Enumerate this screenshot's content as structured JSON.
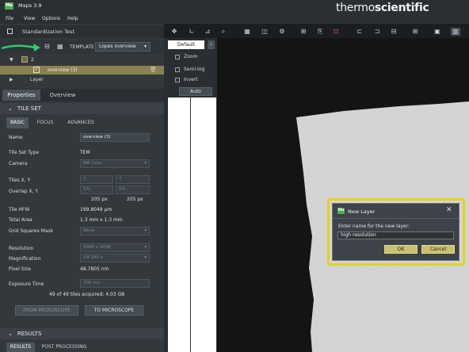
{
  "app": {
    "title": "Maps 3.9",
    "logo_text": "Ma",
    "brand_light": "thermo",
    "brand_bold": "scientific"
  },
  "menu": [
    "File",
    "View",
    "Options",
    "Help"
  ],
  "project": {
    "name": "Standardization Test"
  },
  "template": {
    "label": "TEMPLATE",
    "selected": "Lopes overview"
  },
  "tree": {
    "group_count": "2",
    "item": "overview (3)",
    "layer": "Layer"
  },
  "panel_tabs": {
    "properties": "Properties",
    "overview": "Overview"
  },
  "tile_set": {
    "header": "TILE SET",
    "tabs": [
      "BASIC",
      "FOCUS",
      "ADVANCED"
    ],
    "name_label": "Name",
    "name_value": "overview (3)",
    "type_label": "Tile Set Type",
    "type_value": "TEM",
    "camera_label": "Camera",
    "camera_value": "BM-Ceta",
    "tiles_label": "Tiles X, Y",
    "tiles_x": "7",
    "tiles_y": "7",
    "overlap_label": "Overlap X, Y",
    "overlap_x": "5%",
    "overlap_y": "5%",
    "overlap_px_x": "205 px",
    "overlap_px_y": "205 px",
    "hfw_label": "Tile HFW",
    "hfw_value": "199.8049 µm",
    "area_label": "Total Area",
    "area_value": "1.3 mm x 1.3 mm",
    "mask_label": "Grid Squares Mask",
    "mask_value": "None",
    "resolution_label": "Resolution",
    "resolution_value": "4096 x 4096",
    "mag_label": "Magnification",
    "mag_value": "LM 280 x",
    "pixel_label": "Pixel Size",
    "pixel_value": "48.7805 nm",
    "exposure_label": "Exposure Time",
    "exposure_value": "300 ms",
    "status": "49 of 49 tiles acquired; 4.03 GB",
    "from_button": "FROM MICROSCOPE",
    "to_button": "TO MICROSCOPE"
  },
  "results": {
    "header": "RESULTS",
    "tabs": [
      "RESULTS",
      "POST PROCESSING"
    ]
  },
  "view_options": {
    "preset": "Default",
    "zoom": "Zoom",
    "semilog": "Semi-log",
    "invert": "Invert",
    "auto": "Auto"
  },
  "dialog": {
    "title": "New Layer",
    "prompt": "Enter name for the new layer:",
    "value": "high resolution",
    "ok": "OK",
    "cancel": "Cancel"
  },
  "colors": {
    "highlight": "#e6d21a",
    "arrow": "#2ecc71",
    "selected_row": "#8a8152",
    "logo": "#4caf50"
  },
  "icons": [
    "move-icon",
    "angle-icon",
    "measure-icon",
    "zoom-icon",
    "grid-icon",
    "layers-icon",
    "settings-icon",
    "add-icon",
    "export-icon",
    "crop-icon",
    "frame-icon",
    "frame2-icon",
    "frame3-icon",
    "tiles-icon",
    "image-icon",
    "panel-icon"
  ]
}
